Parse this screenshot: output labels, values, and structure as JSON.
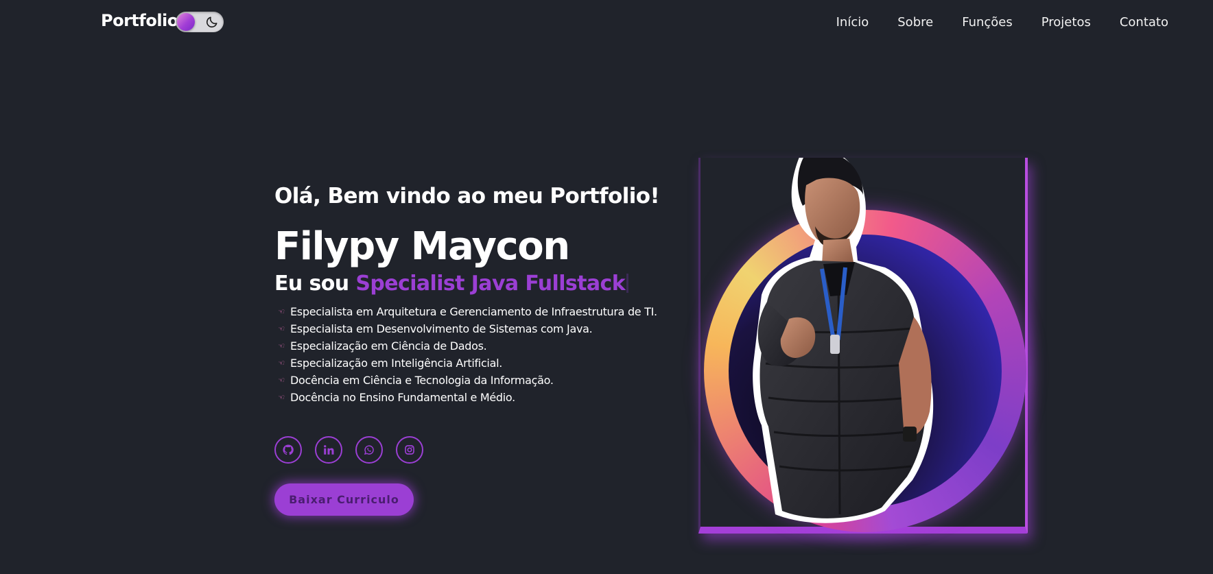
{
  "header": {
    "logo": "Portfolio",
    "nav": [
      "Início",
      "Sobre",
      "Funções",
      "Projetos",
      "Contato"
    ]
  },
  "hero": {
    "greeting": "Olá, Bem vindo ao meu Portfolio!",
    "name": "Filypy Maycon",
    "role_prefix": "Eu sou",
    "role_highlight": "Specialist Java Fullstack",
    "bullets": [
      "Especialista em Arquitetura e Gerenciamento de Infraestrutura de TI.",
      "Especialista em Desenvolvimento de Sistemas com Java.",
      "Especialização em Ciência de Dados.",
      "Especialização em Inteligência Artificial.",
      "Docência em Ciência e Tecnologia da Informação.",
      "Docência no Ensino Fundamental e Médio."
    ],
    "socials": [
      "github-icon",
      "linkedin-icon",
      "whatsapp-icon",
      "instagram-icon"
    ],
    "cv_button": "Baixar Curriculo"
  },
  "colors": {
    "background": "#20232b",
    "accent": "#9b3fd4",
    "bullet_icon": "#e26eb5"
  }
}
